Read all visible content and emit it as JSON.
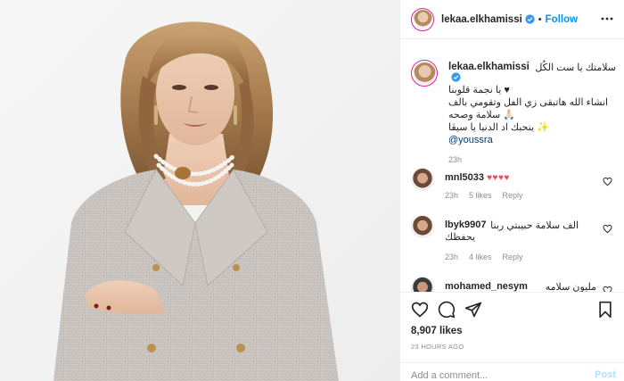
{
  "header": {
    "username": "lekaa.elkhamissi",
    "separator": "•",
    "follow_label": "Follow"
  },
  "caption": {
    "username": "lekaa.elkhamissi",
    "line1": "سلامتك يا ست الكُل",
    "line2": "♥ يا نجمة قلوبنا",
    "line3": "انشاء الله هاتبقى زي الفل وتقومي بالف",
    "line4": "🙏🏻 سلامة وصحه",
    "line5": "✨ ينحبك اد الدنيا يا سيڤا",
    "mention": "@youssra",
    "time": "23h"
  },
  "comments": [
    {
      "username": "mnl5033",
      "text": "♥♥♥♥",
      "time": "23h",
      "likes": "5 likes",
      "reply": "Reply"
    },
    {
      "username": "lbyk9907",
      "text_line1": "الف سلامة حبيبتي ربنا",
      "text_line2": "يحفظك",
      "time": "23h",
      "likes": "4 likes",
      "reply": "Reply"
    },
    {
      "username": "mohamed_nesym",
      "text": "مليون سلامه"
    }
  ],
  "actions": {
    "likes_count": "8,907 likes",
    "time_ago": "23 HOURS AGO",
    "comment_placeholder": "Add a comment...",
    "post_label": "Post"
  },
  "icons": {
    "verified": "verified-badge-icon",
    "more": "more-options-icon",
    "like": "heart-icon",
    "comment": "comment-bubble-icon",
    "share": "paper-plane-icon",
    "save": "bookmark-icon",
    "comment_like": "small-heart-icon"
  },
  "colors": {
    "accent": "#0095f6",
    "verified": "#3897f0",
    "heart": "#ed4956",
    "muted": "#8e8e8e",
    "post_disabled": "#b2dffc"
  }
}
